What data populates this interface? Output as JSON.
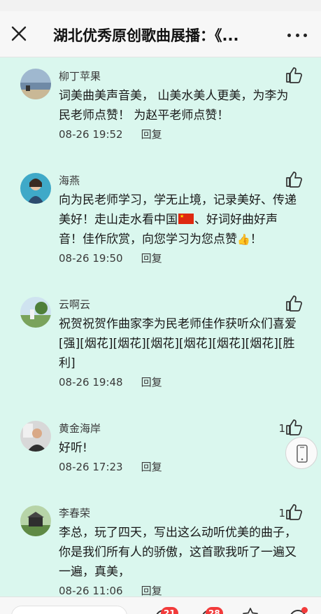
{
  "nav": {
    "title": "湖北优秀原创歌曲展播：《..."
  },
  "comments": [
    {
      "name": "柳丁苹果",
      "text": "词美曲美声音美， 山美水美人更美，为李为民老师点赞！ 为赵平老师点赞！",
      "date": "08-26 19:52",
      "reply": "回复",
      "likes": ""
    },
    {
      "name": "海燕",
      "text_a": "向为民老师学习，学无止境，记录美好、传递美好！走山走水看中国",
      "text_b": "、好词好曲好声音！佳作欣赏，向您学习为您点赞",
      "text_c": "！",
      "date": "08-26 19:50",
      "reply": "回复",
      "likes": ""
    },
    {
      "name": "云啊云",
      "text": "祝贺祝贺作曲家李为民老师佳作获听众们喜爱[强][烟花][烟花][烟花][烟花][烟花][烟花][胜利]",
      "date": "08-26 19:48",
      "reply": "回复",
      "likes": ""
    },
    {
      "name": "黄金海岸",
      "text": "好听!",
      "date": "08-26 17:23",
      "reply": "回复",
      "likes": "1"
    },
    {
      "name": "李春荣",
      "text": "李总，玩了四天，写出这么动听优美的曲子，你是我们所有人的骄傲，这首歌我听了一遍又一遍，真美，",
      "date": "08-26 11:06",
      "reply": "回复",
      "likes": "1"
    }
  ],
  "bottom": {
    "badge_comments": "21",
    "badge_likes": "28"
  }
}
